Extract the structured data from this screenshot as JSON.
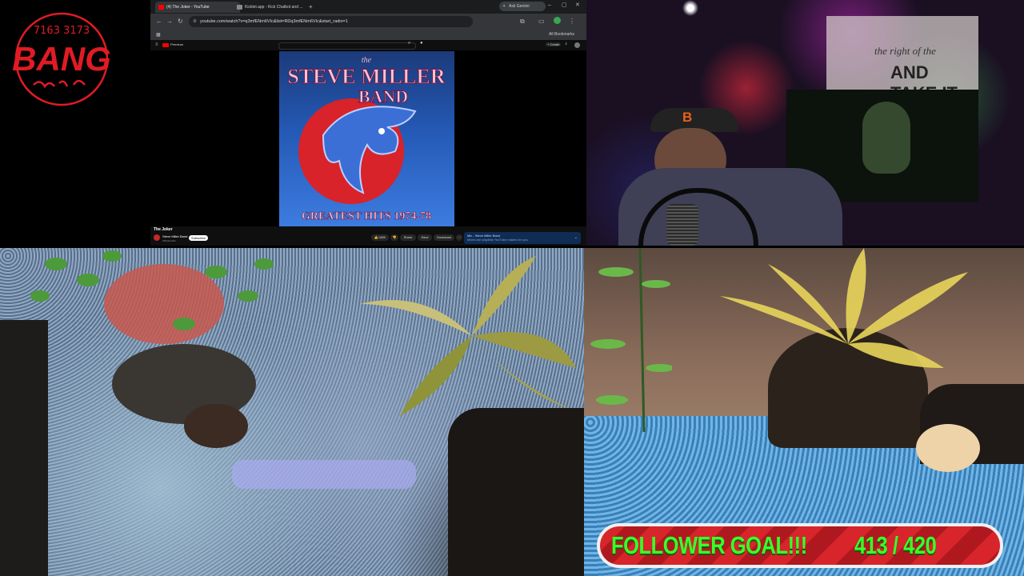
{
  "logo": {
    "text": "BANG",
    "ring_text": "7163 3173"
  },
  "browser": {
    "tabs": [
      {
        "label": "(4) The Joker - YouTube",
        "active": true
      },
      {
        "label": "Kicklet.app - Kick Chatbot and ...",
        "active": false
      }
    ],
    "ask_button": "Ask Gemini",
    "url": "youtube.com/watch?v=q3mfENm6VIc&list=RDq3mfENm6VIc&start_radio=1",
    "all_bookmarks": "All Bookmarks",
    "youtube_brand": "Premium",
    "create_button": "+ Create",
    "album": {
      "band_top": "the",
      "band_title": "STEVE MILLER",
      "band_sub": "BAND",
      "album_title": "GREATEST HITS 1974-78"
    },
    "video_title": "The Joker",
    "channel": "Steve Miller Band",
    "subscribers": "Official Artist",
    "subscribe_label": "Subscribe",
    "actions": {
      "likes": "145K",
      "share": "Share",
      "save": "Save",
      "download": "Download"
    },
    "up_next": {
      "title": "Mix - Steve Miller Band",
      "subtitle": "Mixes are playlists YouTube makes for you"
    }
  },
  "cam": {
    "banner_text": "AND TAKE IT",
    "banner_line": "the right of the"
  },
  "goal": {
    "label": "FOLLOWER GOAL!!!",
    "count": "413 / 420",
    "current": 413,
    "target": 420
  },
  "colors": {
    "goal_text": "#39ff2c",
    "goal_bar": "#d8242b",
    "logo_red": "#e01b24"
  }
}
